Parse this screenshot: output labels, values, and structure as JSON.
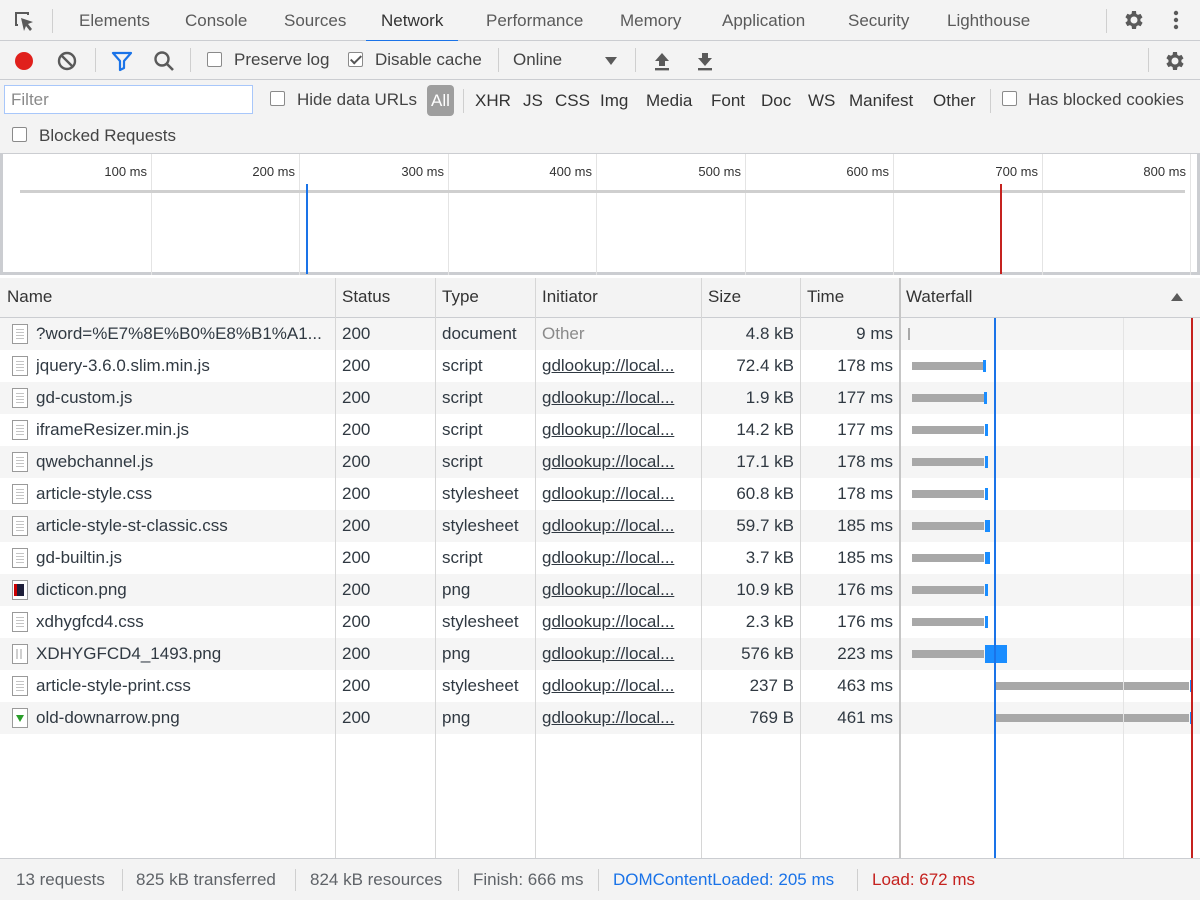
{
  "tabs": [
    {
      "label": "Elements"
    },
    {
      "label": "Console"
    },
    {
      "label": "Sources"
    },
    {
      "label": "Network",
      "active": true
    },
    {
      "label": "Performance"
    },
    {
      "label": "Memory"
    },
    {
      "label": "Application"
    },
    {
      "label": "Security"
    },
    {
      "label": "Lighthouse"
    }
  ],
  "toolbar": {
    "preserve_log_label": "Preserve log",
    "preserve_log_checked": false,
    "disable_cache_label": "Disable cache",
    "disable_cache_checked": true,
    "throttling_value": "Online",
    "recording_color": "#e0201c",
    "filter_color": "#1a73e8"
  },
  "filterbar": {
    "filter_placeholder": "Filter",
    "hide_data_urls_label": "Hide data URLs",
    "hide_data_urls_checked": false,
    "types": [
      "All",
      "XHR",
      "JS",
      "CSS",
      "Img",
      "Media",
      "Font",
      "Doc",
      "WS",
      "Manifest",
      "Other"
    ],
    "active_type": "All",
    "has_blocked_cookies_label": "Has blocked cookies",
    "has_blocked_cookies_checked": false,
    "blocked_requests_label": "Blocked Requests",
    "blocked_requests_checked": false
  },
  "overview": {
    "ticks": [
      "100 ms",
      "200 ms",
      "300 ms",
      "400 ms",
      "500 ms",
      "600 ms",
      "700 ms",
      "800 ms"
    ],
    "dom_content_loaded_ms": 205,
    "load_ms": 672,
    "dcl_color": "#1a73e8",
    "load_color": "#c5221f"
  },
  "table": {
    "columns": {
      "name": "Name",
      "status": "Status",
      "type": "Type",
      "initiator": "Initiator",
      "size": "Size",
      "time": "Time",
      "waterfall": "Waterfall"
    },
    "rows": [
      {
        "name": "?word=%E7%8E%B0%E8%B1%A1...",
        "status": "200",
        "type": "document",
        "initiator": "Other",
        "size": "4.8 kB",
        "time": "9 ms",
        "icon": "doc",
        "wf_wait_start": 0,
        "wf_wait_end": 2,
        "wf_dl_end": 2
      },
      {
        "name": "jquery-3.6.0.slim.min.js",
        "status": "200",
        "type": "script",
        "initiator": "gdlookup://local...",
        "size": "72.4 kB",
        "time": "178 ms",
        "icon": "doc",
        "wf_wait_start": 10,
        "wf_wait_end": 178,
        "wf_dl_end": 186
      },
      {
        "name": "gd-custom.js",
        "status": "200",
        "type": "script",
        "initiator": "gdlookup://local...",
        "size": "1.9 kB",
        "time": "177 ms",
        "icon": "doc",
        "wf_wait_start": 10,
        "wf_wait_end": 180,
        "wf_dl_end": 186
      },
      {
        "name": "iframeResizer.min.js",
        "status": "200",
        "type": "script",
        "initiator": "gdlookup://local...",
        "size": "14.2 kB",
        "time": "177 ms",
        "icon": "doc",
        "wf_wait_start": 10,
        "wf_wait_end": 182,
        "wf_dl_end": 186
      },
      {
        "name": "qwebchannel.js",
        "status": "200",
        "type": "script",
        "initiator": "gdlookup://local...",
        "size": "17.1 kB",
        "time": "178 ms",
        "icon": "doc",
        "wf_wait_start": 10,
        "wf_wait_end": 182,
        "wf_dl_end": 186
      },
      {
        "name": "article-style.css",
        "status": "200",
        "type": "stylesheet",
        "initiator": "gdlookup://local...",
        "size": "60.8 kB",
        "time": "178 ms",
        "icon": "doc",
        "wf_wait_start": 10,
        "wf_wait_end": 182,
        "wf_dl_end": 186
      },
      {
        "name": "article-style-st-classic.css",
        "status": "200",
        "type": "stylesheet",
        "initiator": "gdlookup://local...",
        "size": "59.7 kB",
        "time": "185 ms",
        "icon": "doc",
        "wf_wait_start": 10,
        "wf_wait_end": 182,
        "wf_dl_end": 194
      },
      {
        "name": "gd-builtin.js",
        "status": "200",
        "type": "script",
        "initiator": "gdlookup://local...",
        "size": "3.7 kB",
        "time": "185 ms",
        "icon": "doc",
        "wf_wait_start": 10,
        "wf_wait_end": 182,
        "wf_dl_end": 194
      },
      {
        "name": "dicticon.png",
        "status": "200",
        "type": "png",
        "initiator": "gdlookup://local...",
        "size": "10.9 kB",
        "time": "176 ms",
        "icon": "img-dark",
        "wf_wait_start": 10,
        "wf_wait_end": 182,
        "wf_dl_end": 187
      },
      {
        "name": "xdhygfcd4.css",
        "status": "200",
        "type": "stylesheet",
        "initiator": "gdlookup://local...",
        "size": "2.3 kB",
        "time": "176 ms",
        "icon": "doc",
        "wf_wait_start": 10,
        "wf_wait_end": 182,
        "wf_dl_end": 185
      },
      {
        "name": "XDHYGFCD4_1493.png",
        "status": "200",
        "type": "png",
        "initiator": "gdlookup://local...",
        "size": "576 kB",
        "time": "223 ms",
        "icon": "img-stripe",
        "wf_wait_start": 10,
        "wf_wait_end": 182,
        "wf_dl_end": 235
      },
      {
        "name": "article-style-print.css",
        "status": "200",
        "type": "stylesheet",
        "initiator": "gdlookup://local...",
        "size": "237 B",
        "time": "463 ms",
        "icon": "doc",
        "wf_wait_start": 207,
        "wf_wait_end": 668,
        "wf_dl_end": 670
      },
      {
        "name": "old-downarrow.png",
        "status": "200",
        "type": "png",
        "initiator": "gdlookup://local...",
        "size": "769 B",
        "time": "461 ms",
        "icon": "img-arrow",
        "wf_wait_start": 207,
        "wf_wait_end": 668,
        "wf_dl_end": 670
      }
    ],
    "waterfall_dcl_ms": 205,
    "waterfall_load_ms": 672
  },
  "statusbar": {
    "requests": "13 requests",
    "transferred": "825 kB transferred",
    "resources": "824 kB resources",
    "finish": "Finish: 666 ms",
    "dcl": "DOMContentLoaded: 205 ms",
    "load": "Load: 672 ms"
  }
}
